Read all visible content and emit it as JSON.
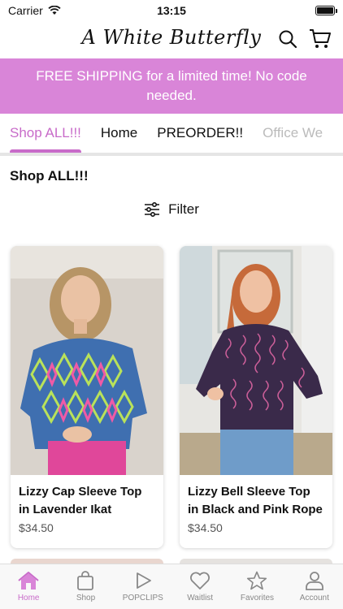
{
  "status_bar": {
    "carrier": "Carrier",
    "time": "13:15"
  },
  "header": {
    "logo_text": "A White Butterfly"
  },
  "promo": {
    "text": "FREE SHIPPING for a limited time! No code needed."
  },
  "nav": {
    "tabs": [
      {
        "label": "Shop ALL!!!",
        "active": true
      },
      {
        "label": "Home"
      },
      {
        "label": "PREORDER!!"
      },
      {
        "label": "Office We"
      }
    ]
  },
  "page": {
    "title": "Shop ALL!!!",
    "filter_label": "Filter"
  },
  "products": [
    {
      "name": "Lizzy Cap Sleeve Top in Lavender Ikat",
      "price": "$34.50"
    },
    {
      "name": "Lizzy Bell Sleeve Top in Black and Pink Rope",
      "price": "$34.50"
    }
  ],
  "tabbar": {
    "items": [
      {
        "label": "Home",
        "icon": "home-icon",
        "active": true
      },
      {
        "label": "Shop",
        "icon": "bag-icon"
      },
      {
        "label": "POPCLIPS",
        "icon": "play-icon"
      },
      {
        "label": "Waitlist",
        "icon": "heart-icon"
      },
      {
        "label": "Favorites",
        "icon": "star-icon"
      },
      {
        "label": "Account",
        "icon": "person-icon"
      }
    ]
  },
  "colors": {
    "accent": "#c86bc9",
    "banner": "#d985d8"
  }
}
